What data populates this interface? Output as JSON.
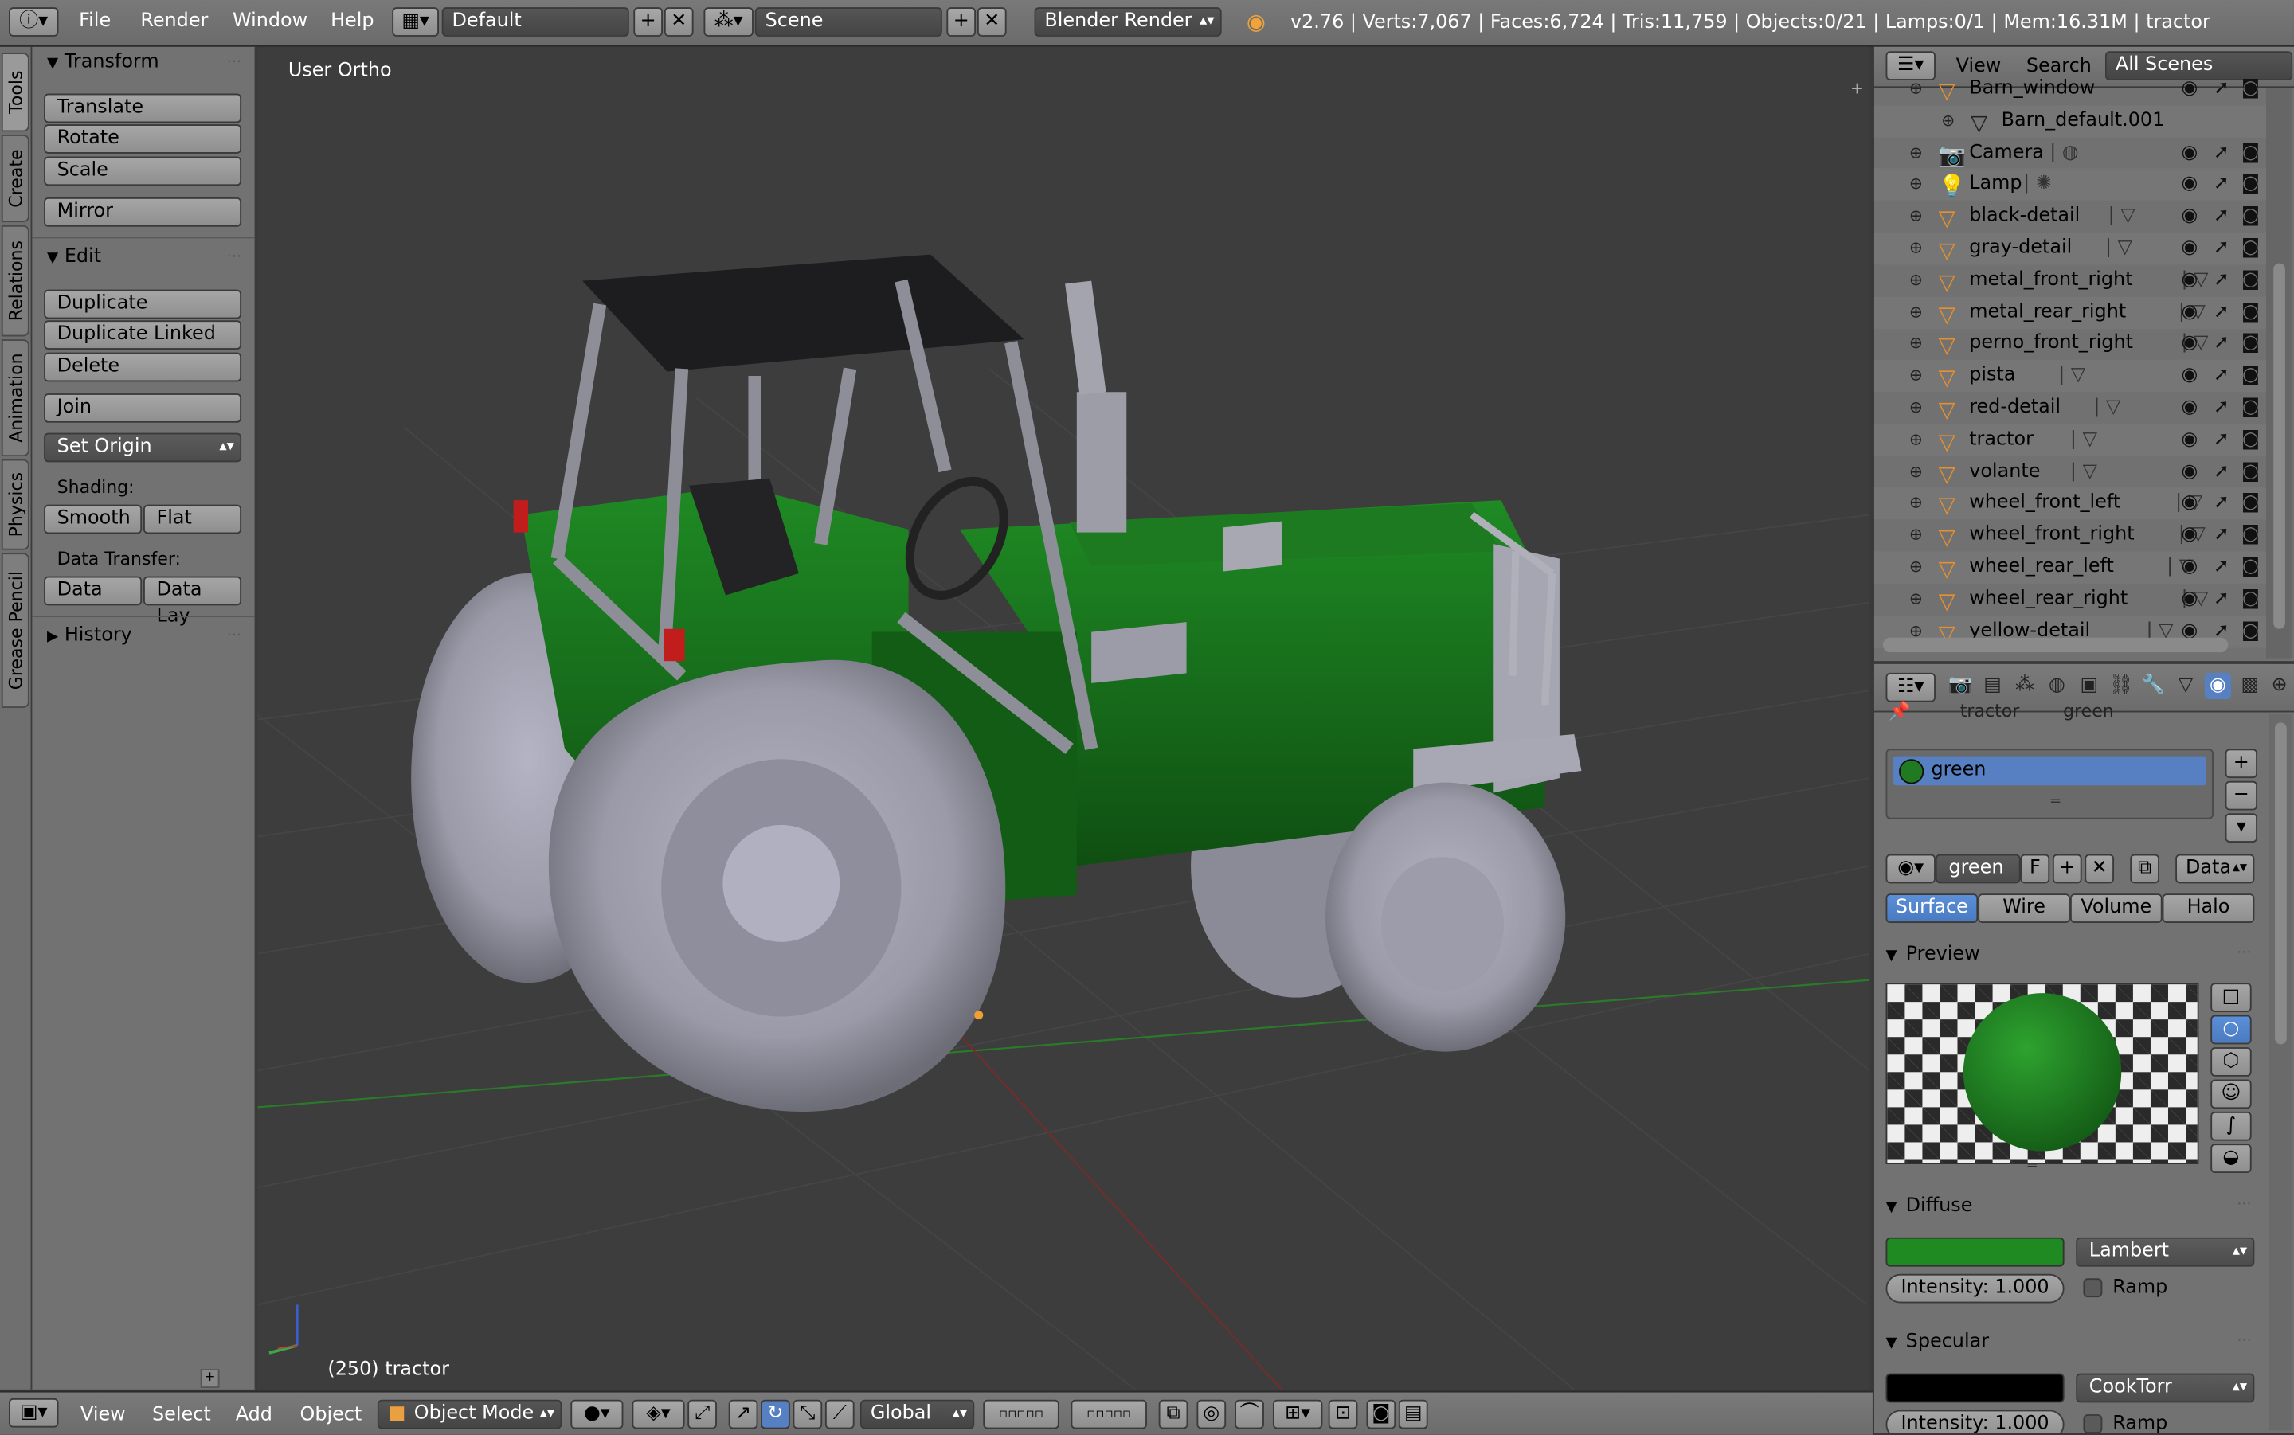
{
  "topbar": {
    "menus": [
      "File",
      "Render",
      "Window",
      "Help"
    ],
    "layout": "Default",
    "scene": "Scene",
    "engine": "Blender Render",
    "stats": "v2.76 | Verts:7,067 | Faces:6,724 | Tris:11,759 | Objects:0/21 | Lamps:0/1 | Mem:16.31M | tractor"
  },
  "tabs": [
    "Tools",
    "Create",
    "Relations",
    "Animation",
    "Physics",
    "Grease Pencil"
  ],
  "toolshelf": {
    "transform_title": "Transform",
    "translate": "Translate",
    "rotate": "Rotate",
    "scale": "Scale",
    "mirror": "Mirror",
    "edit_title": "Edit",
    "duplicate": "Duplicate",
    "duplicate_linked": "Duplicate Linked",
    "delete": "Delete",
    "join": "Join",
    "set_origin": "Set Origin",
    "shading_label": "Shading:",
    "smooth": "Smooth",
    "flat": "Flat",
    "data_transfer_label": "Data Transfer:",
    "data": "Data",
    "data_lay": "Data Lay",
    "history_title": "History"
  },
  "viewport": {
    "title": "User Ortho",
    "info": "(250) tractor"
  },
  "bottombar": {
    "menus": [
      "View",
      "Select",
      "Add",
      "Object"
    ],
    "mode": "Object Mode",
    "orientation": "Global"
  },
  "outliner": {
    "view": "View",
    "search": "Search",
    "scenes": "All Scenes",
    "rows": [
      {
        "name": "Barn_window",
        "icon": "mesh-icon",
        "level": 1
      },
      {
        "name": "Barn_default.001",
        "icon": "mesh-data-icon",
        "level": 2
      },
      {
        "name": "Camera",
        "icon": "camera-icon",
        "level": 0
      },
      {
        "name": "Lamp",
        "icon": "lamp-icon",
        "level": 0
      },
      {
        "name": "black-detail",
        "icon": "mesh-icon",
        "level": 0
      },
      {
        "name": "gray-detail",
        "icon": "mesh-icon",
        "level": 0
      },
      {
        "name": "metal_front_right",
        "icon": "mesh-icon",
        "level": 0
      },
      {
        "name": "metal_rear_right",
        "icon": "mesh-icon",
        "level": 0
      },
      {
        "name": "perno_front_right",
        "icon": "mesh-icon",
        "level": 0
      },
      {
        "name": "pista",
        "icon": "mesh-icon",
        "level": 0
      },
      {
        "name": "red-detail",
        "icon": "mesh-icon",
        "level": 0
      },
      {
        "name": "tractor",
        "icon": "mesh-icon",
        "level": 0
      },
      {
        "name": "volante",
        "icon": "mesh-icon",
        "level": 0
      },
      {
        "name": "wheel_front_left",
        "icon": "mesh-icon",
        "level": 0
      },
      {
        "name": "wheel_front_right",
        "icon": "mesh-icon",
        "level": 0
      },
      {
        "name": "wheel_rear_left",
        "icon": "mesh-icon",
        "level": 0
      },
      {
        "name": "wheel_rear_right",
        "icon": "mesh-icon",
        "level": 0
      },
      {
        "name": "yellow-detail",
        "icon": "mesh-icon",
        "level": 0
      }
    ]
  },
  "props": {
    "breadcrumb_object": "tractor",
    "breadcrumb_material": "green",
    "slot_name": "green",
    "material_name": "green",
    "fake_user": "F",
    "link": "Data",
    "tabs_type": [
      "Surface",
      "Wire",
      "Volume",
      "Halo"
    ],
    "preview_title": "Preview",
    "diffuse_title": "Diffuse",
    "diffuse_color": "#1f8a22",
    "diffuse_shader": "Lambert",
    "diffuse_intensity": "Intensity: 1.000",
    "ramp": "Ramp",
    "specular_title": "Specular",
    "specular_color": "#000000",
    "specular_shader": "CookTorr",
    "specular_intensity": "Intensity: 1.000",
    "ramp2": "Ramp"
  },
  "colors": {
    "accent": "#5680c2",
    "tractor_green": "#1f7a22"
  }
}
